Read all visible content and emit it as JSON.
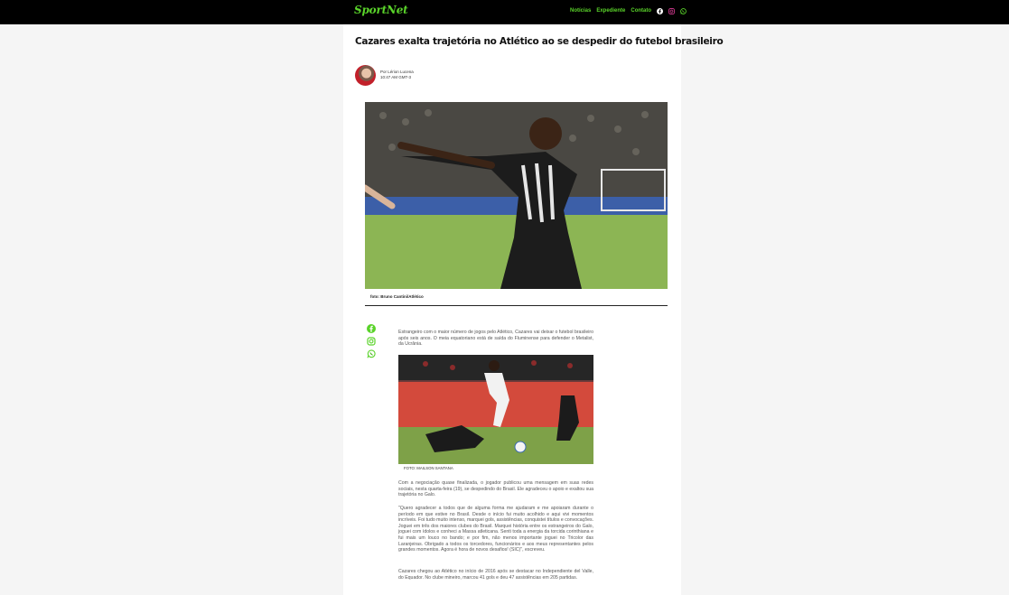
{
  "header": {
    "logo": "SportNet",
    "nav": [
      "Notícias",
      "Expediente",
      "Contato"
    ],
    "social_icons": [
      "facebook-icon",
      "instagram-icon",
      "whatsapp-icon"
    ],
    "accent_color": "#5ad32a",
    "instagram_color": "#c13584"
  },
  "article": {
    "title": "Cazares exalta trajetória no Atlético ao se despedir do futebol brasileiro",
    "author": "Por Lérion Lucena",
    "time": "10:47 AM GMT-3",
    "hero_caption": "foto: Bruno Cantini/Atlético",
    "share_icons": [
      "facebook-icon",
      "instagram-icon",
      "whatsapp-icon"
    ],
    "paragraphs": [
      "Estrangeiro com o maior número de jogos pelo Atlético, Cazares vai deixar o futebol brasileiro após seis anos. O meia equatoriano está de saída do Fluminense para defender o Metalist, da Ucrânia.",
      "Com a negociação quase finalizada, o jogador publicou uma mensagem em suas redes sociais, nesta quarta-feira (19), se despedindo do Brasil. Ele agradeceu o apoio e exaltou sua trajetória no Galo.",
      "\"Quero agradecer a todos que de alguma forma me ajudaram e me apoiaram durante o período em que estive no Brasil. Desde o início fui muito acolhido e aqui vivi momentos incríveis. Foi tudo muito intenso, marquei gols, assistências, conquistei títulos e convocações. Joguei em três dos maiores clubes do Brasil. Marquei história entre os estrangeiros do Galo, joguei com ídolos e conheci a Massa atleticana. Senti toda a energia da torcida corinthiana e fui mais um louco no bando; e por fim, não menos importante joguei no Tricolor das Laranjeiras. Obrigado a todos os torcedores, funcionários e aos meus representantes pelos grandes momentos. Agora é hora de novos desafios! (SIC)\", escreveu.",
      "Cazares chegou ao Atlético no início de 2016 após se destacar no Independiente del Valle, do Equador. No clube mineiro, marcou 41 gols e deu 47 assistências em 205 partidas."
    ],
    "photo2_caption": "FOTO: MAILSON SANTANA"
  }
}
